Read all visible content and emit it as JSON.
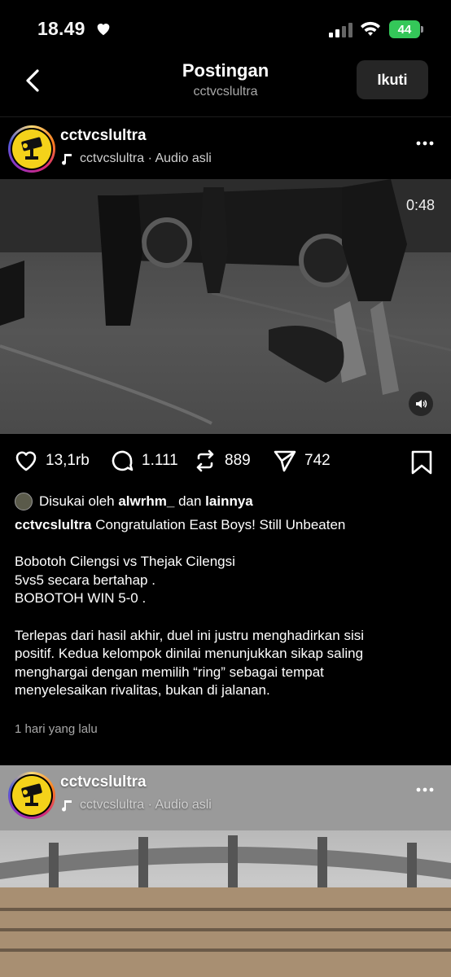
{
  "status_bar": {
    "time": "18.49",
    "battery": "44"
  },
  "header": {
    "title": "Postingan",
    "subtitle": "cctvcslultra",
    "follow_label": "Ikuti"
  },
  "post": {
    "username": "cctvcslultra",
    "audio_label": "cctvcslultra · Audio asli",
    "video_duration": "0:48",
    "likes_count": "13,1rb",
    "comments_count": "1.111",
    "reposts_count": "889",
    "shares_count": "742",
    "liked_by_prefix": "Disukai oleh",
    "liked_by_user": "alwrhm_",
    "liked_by_and": "dan",
    "liked_by_others": "lainnya",
    "caption_username": "cctvcslultra",
    "caption_first": "Congratulation East Boys! Still Unbeaten",
    "caption_lines": [
      "",
      "Bobotoh Cilengsi vs Thejak Cilengsi",
      "5vs5 secara bertahap .",
      "BOBOTOH WIN 5-0 .",
      "",
      "Terlepas dari hasil akhir, duel ini justru menghadirkan sisi",
      "positif. Kedua kelompok dinilai menunjukkan sikap saling",
      "menghargai dengan memilih “ring” sebagai tempat",
      "menyelesaikan rivalitas, bukan di jalanan."
    ],
    "time_ago": "1 hari yang lalu"
  },
  "next_post": {
    "username": "cctvcslultra",
    "audio_label": "cctvcslultra · Audio asli"
  },
  "colors": {
    "background": "#000000",
    "battery": "#34c759",
    "avatar_bg": "#f4d21a"
  }
}
